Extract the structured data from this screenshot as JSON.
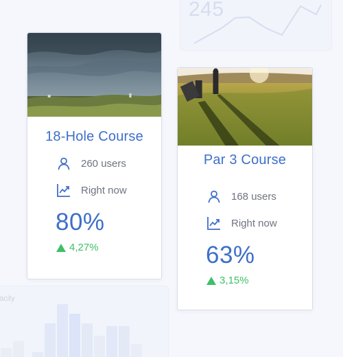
{
  "background": {
    "top_widget_value": "245",
    "bottom_widget_label": "acity"
  },
  "cards": [
    {
      "title": "18-Hole Course",
      "users": "260 users",
      "time_label": "Right now",
      "percent": "80%",
      "change": "4,27%",
      "image": "course-landscape-cloudy"
    },
    {
      "title": "Par 3 Course",
      "users": "168 users",
      "time_label": "Right now",
      "percent": "63%",
      "change": "3,15%",
      "image": "golfers-sunset"
    }
  ],
  "colors": {
    "accent": "#3e6fc8",
    "positive": "#3fbf66",
    "muted_text": "#6f7380"
  }
}
